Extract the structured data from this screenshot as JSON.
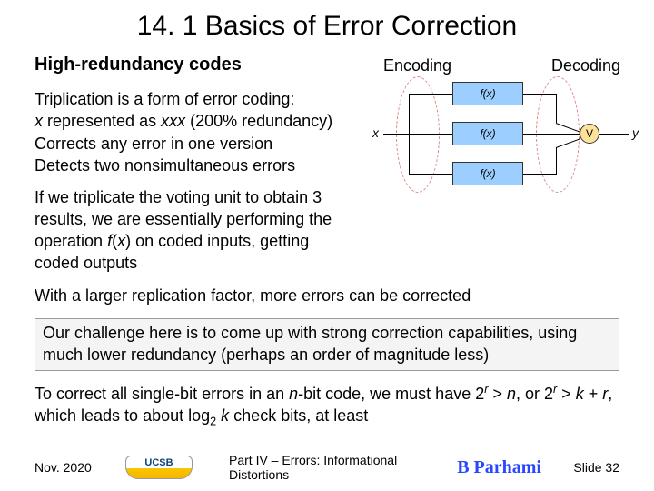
{
  "title": "14. 1  Basics of Error Correction",
  "subhead": "High-redundancy codes",
  "labels": {
    "encoding": "Encoding",
    "decoding": "Decoding",
    "x": "x",
    "y": "y",
    "fx": "f(x)",
    "v": "V"
  },
  "triplication": {
    "l1": "Triplication is a form of error coding:",
    "l2a": "x",
    "l2b": " represented as ",
    "l2c": "xxx",
    "l2d": " (200% redundancy)",
    "l3": "Corrects any error in one version",
    "l4": "Detects two nonsimultaneous errors"
  },
  "paras": {
    "p2a": "If we triplicate the voting unit to obtain 3 results, we are essentially performing the operation ",
    "p2b": "f",
    "p2c": "(",
    "p2d": "x",
    "p2e": ") on coded inputs, getting coded outputs",
    "p3": "With a larger replication factor, more errors can be corrected",
    "callout": "Our challenge here is to come up with strong correction capabilities, using much lower redundancy (perhaps an order of magnitude less)",
    "p5": {
      "a": "To correct all single-bit errors in an ",
      "n1": "n",
      "b": "-bit code, we must have 2",
      "r1": "r",
      "c": " > ",
      "n2": "n",
      "d": ", or 2",
      "r2": "r",
      "e": " > ",
      "k1": "k",
      "f": " + ",
      "r3": "r",
      "g": ", which leads to about log",
      "two": "2",
      "sp": " ",
      "k2": "k",
      "h": " check bits, at least"
    }
  },
  "footer": {
    "date": "Nov. 2020",
    "logo": "UCSB",
    "part": "Part IV – Errors: Informational Distortions",
    "signature": "B Parhami",
    "slide": "Slide 32"
  }
}
